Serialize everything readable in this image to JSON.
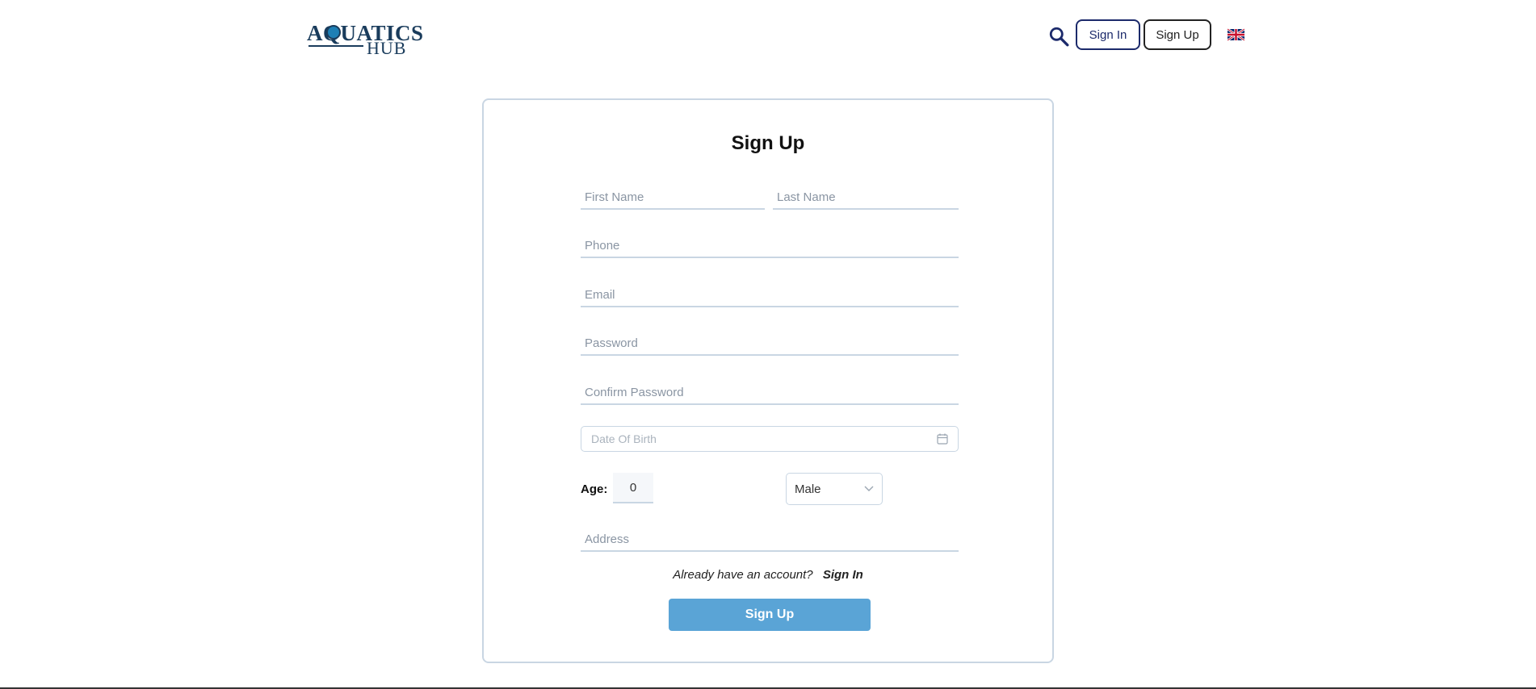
{
  "header": {
    "logo_main": "AQUATICS",
    "logo_sub": "HUB",
    "signin_label": "Sign In",
    "signup_label": "Sign Up",
    "language_icon": "uk-flag-icon"
  },
  "form": {
    "title": "Sign Up",
    "first_name_placeholder": "First Name",
    "last_name_placeholder": "Last Name",
    "phone_placeholder": "Phone",
    "email_placeholder": "Email",
    "password_placeholder": "Password",
    "confirm_password_placeholder": "Confirm Password",
    "dob_placeholder": "Date Of Birth",
    "age_label": "Age:",
    "age_value": "0",
    "gender_value": "Male",
    "address_placeholder": "Address",
    "already_text": "Already have an account?",
    "signin_link": "Sign In",
    "submit_label": "Sign Up"
  },
  "colors": {
    "primary": "#5aa4d6",
    "nav_border": "#1c2a6b",
    "field_border": "#c9d6e3"
  }
}
